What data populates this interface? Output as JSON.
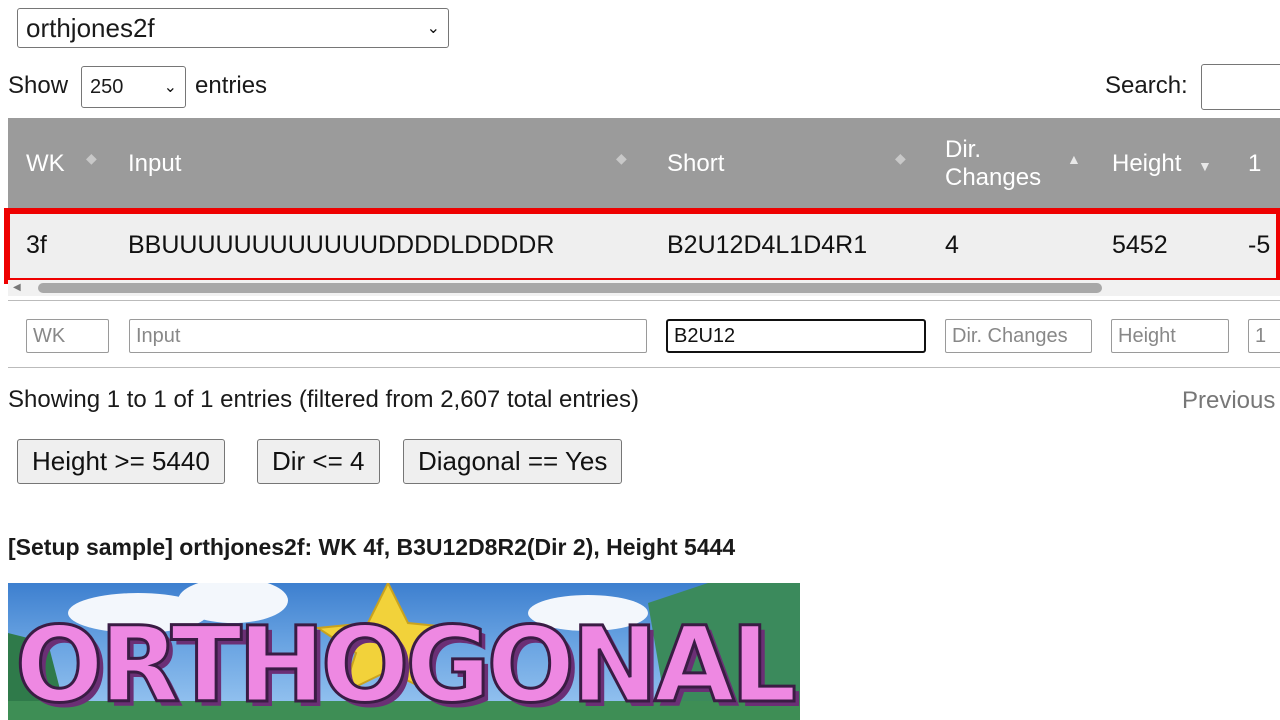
{
  "setup_select": {
    "value": "orthjones2f"
  },
  "length_menu": {
    "show_label": "Show",
    "value": "250",
    "entries_label": "entries"
  },
  "search": {
    "label": "Search:",
    "value": ""
  },
  "table": {
    "columns": [
      "WK",
      "Input",
      "Short",
      "Dir.",
      "Changes",
      "Height",
      "1"
    ],
    "rows": [
      {
        "wk": "3f",
        "input": "BBUUUUUUUUUUUUDDDDLDDDDR",
        "short": "B2U12D4L1D4R1",
        "dir_changes": "4",
        "height": "5452",
        "col1": "-5"
      }
    ],
    "filters": {
      "wk_placeholder": "WK",
      "input_placeholder": "Input",
      "short_value": "B2U12",
      "dir_placeholder": "Dir. Changes",
      "height_placeholder": "Height",
      "col1_placeholder": "1"
    }
  },
  "info": "Showing 1 to 1 of 1 entries (filtered from 2,607 total entries)",
  "pagination": {
    "previous": "Previous"
  },
  "quick_filters": [
    "Height >= 5440",
    "Dir <= 4",
    "Diagonal == Yes"
  ],
  "setup_sample": "[Setup sample] orthjones2f: WK 4f, B3U12D8R2(Dir 2), Height 5444",
  "banner": {
    "text": "ORTHOGONAL"
  },
  "colors": {
    "header_bg": "#9b9b9b",
    "highlight": "#ee0000",
    "banner_text": "#ee88e2"
  }
}
